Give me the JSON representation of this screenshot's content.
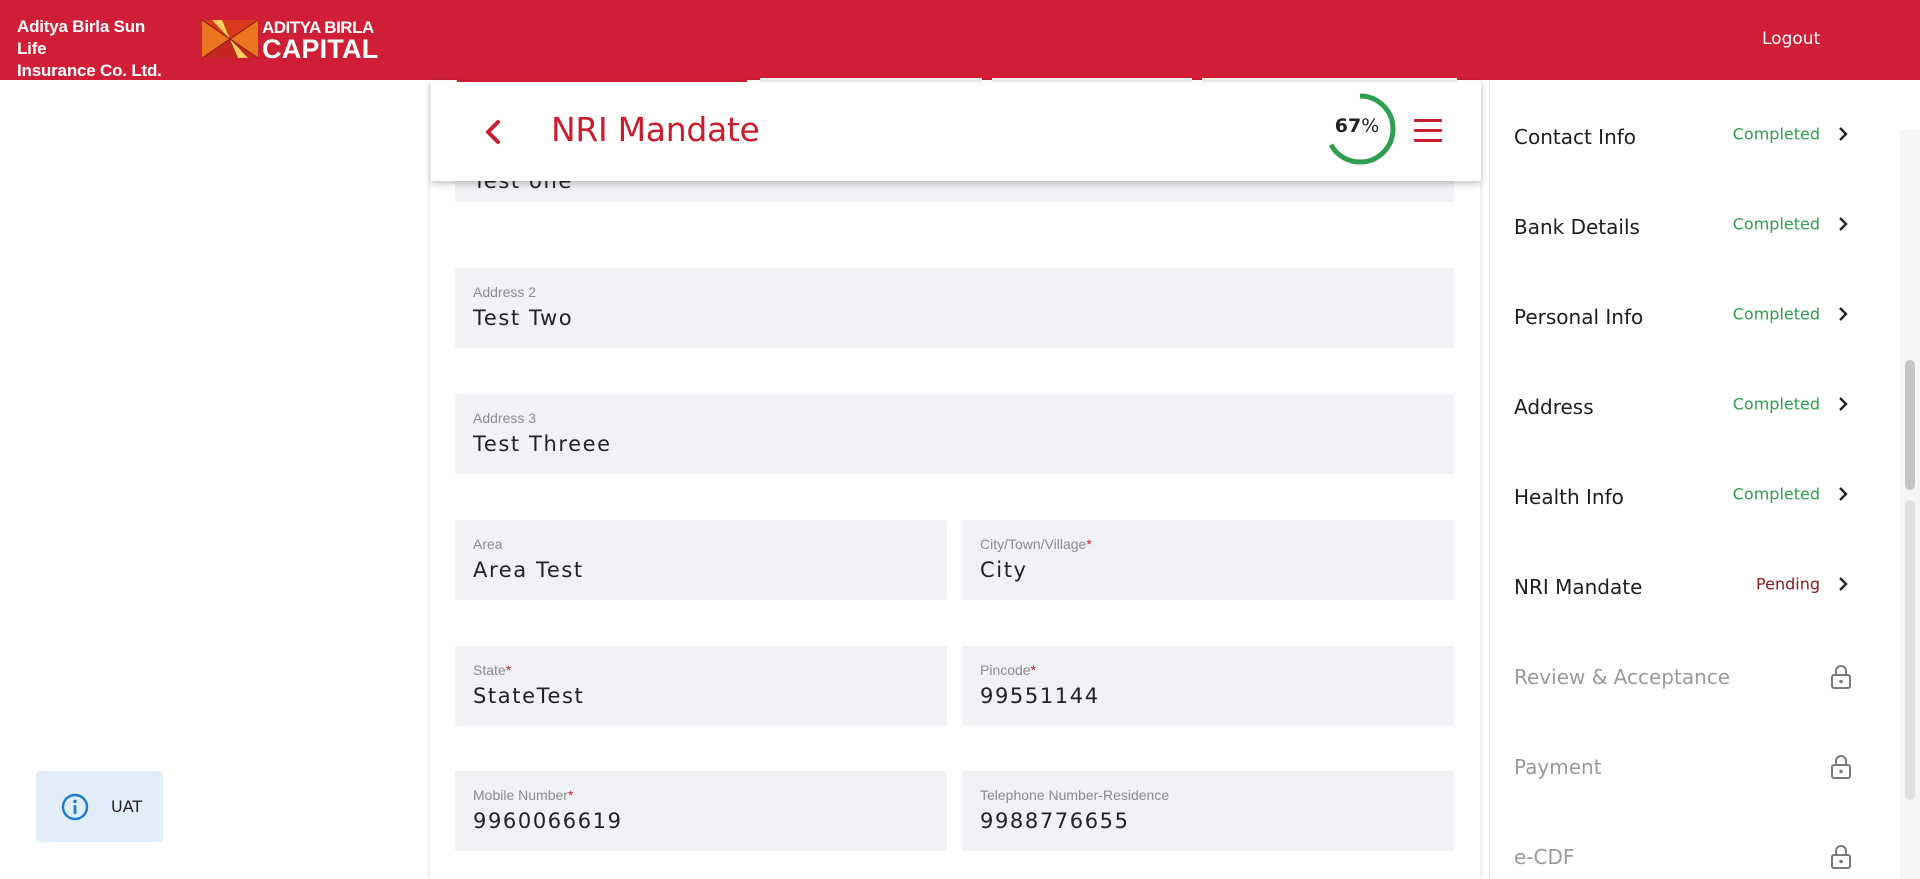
{
  "header": {
    "company_line1": "Aditya Birla Sun Life",
    "company_line2": "Insurance Co. Ltd.",
    "logo_line1": "ADITYA BIRLA",
    "logo_line2": "CAPITAL",
    "logout_label": "Logout",
    "brand_color": "#cf1e35"
  },
  "page": {
    "title": "NRI Mandate",
    "progress_percent": 67,
    "progress_number": "67",
    "progress_suffix": "%",
    "icons": {
      "back": "chevron-left-icon",
      "menu": "hamburger-menu-icon"
    }
  },
  "form": {
    "address1_value": "Test one",
    "address2": {
      "label": "Address 2",
      "value": "Test Two"
    },
    "address3": {
      "label": "Address 3",
      "value": "Test Threee"
    },
    "area": {
      "label": "Area",
      "value": "Area Test"
    },
    "city": {
      "label": "City/Town/Village",
      "required": "*",
      "value": "City"
    },
    "state": {
      "label": "State",
      "required": "*",
      "value": "StateTest"
    },
    "pincode": {
      "label": "Pincode",
      "required": "*",
      "value": "99551144"
    },
    "mobile": {
      "label": "Mobile Number",
      "required": "*",
      "value": "9960066619"
    },
    "telephone": {
      "label": "Telephone Number-Residence",
      "value": "9988776655"
    }
  },
  "steps": [
    {
      "name": "Contact Info",
      "status": "Completed",
      "state": "done"
    },
    {
      "name": "Bank Details",
      "status": "Completed",
      "state": "done"
    },
    {
      "name": "Personal Info",
      "status": "Completed",
      "state": "done"
    },
    {
      "name": "Address",
      "status": "Completed",
      "state": "done"
    },
    {
      "name": "Health Info",
      "status": "Completed",
      "state": "done"
    },
    {
      "name": "NRI Mandate",
      "status": "Pending",
      "state": "pending"
    },
    {
      "name": "Review & Acceptance",
      "status": "",
      "state": "locked"
    },
    {
      "name": "Payment",
      "status": "",
      "state": "locked"
    },
    {
      "name": "e-CDF",
      "status": "",
      "state": "locked"
    }
  ],
  "env_badge": {
    "label": "UAT",
    "icon": "info-icon"
  },
  "colors": {
    "accent_red": "#c81e2e",
    "completed_green": "#2e9e4f",
    "pending_red": "#8b1a20",
    "field_bg": "#f1f2f6"
  }
}
